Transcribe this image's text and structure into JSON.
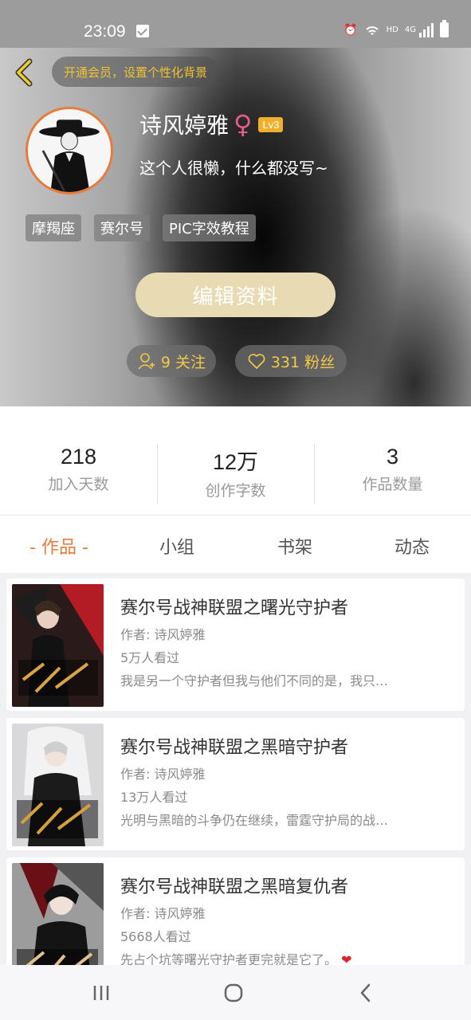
{
  "status_bar": {
    "time": "23:09",
    "network_label": "HD",
    "network_gen": "4G"
  },
  "header": {
    "vip_prompt": "开通会员，设置个性化背景",
    "username": "诗风婷雅",
    "gender_symbol": "♀",
    "level": "Lv3",
    "bio": "这个人很懒，什么都没写~",
    "tags": [
      "摩羯座",
      "赛尔号",
      "PIC字效教程"
    ],
    "edit_button": "编辑资料",
    "following": "9 关注",
    "followers": "331 粉丝"
  },
  "stats": [
    {
      "value": "218",
      "label": "加入天数"
    },
    {
      "value": "12万",
      "label": "创作字数"
    },
    {
      "value": "3",
      "label": "作品数量"
    }
  ],
  "tabs": [
    {
      "label": "- 作品 -",
      "active": true
    },
    {
      "label": "小组",
      "active": false
    },
    {
      "label": "书架",
      "active": false
    },
    {
      "label": "动态",
      "active": false
    }
  ],
  "works": [
    {
      "title": "赛尔号战神联盟之曙光守护者",
      "author": "作者: 诗风婷雅",
      "views": "5万人看过",
      "description": "我是另一个守护者但我与他们不同的是，我只…"
    },
    {
      "title": "赛尔号战神联盟之黑暗守护者",
      "author": "作者: 诗风婷雅",
      "views": "13万人看过",
      "description": "光明与黑暗的斗争仍在继续，雷霆守护局的战…"
    },
    {
      "title": "赛尔号战神联盟之黑暗复仇者",
      "author": "作者: 诗风婷雅",
      "views": "5668人看过",
      "description": "先占个坑等曙光守护者更完就是它了。",
      "emoji": "❤"
    }
  ],
  "colors": {
    "accent": "#e97a3a",
    "gold": "#f3c94a",
    "edit_button_bg": "#e8dbb4",
    "gender": "#e45b8c",
    "level_badge": "#f0b02d"
  },
  "icons": {
    "back": "chevron-left-icon",
    "follow": "person-add-icon",
    "fans": "heart-outline-icon",
    "nav_recent": "recent-apps-icon",
    "nav_home": "home-icon",
    "nav_back": "back-icon"
  }
}
